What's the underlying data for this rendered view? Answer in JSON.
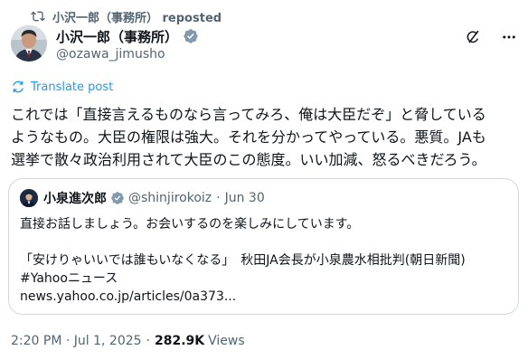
{
  "repost": {
    "text": "小沢一郎（事務所） reposted"
  },
  "post": {
    "author_name": "小沢一郎（事務所）",
    "handle": "@ozawa_jimusho",
    "translate_label": "Translate post",
    "body": "これでは「直接言えるものなら言ってみろ、俺は大臣だぞ」と脅している\nようなもの。大臣の権限は強大。それを分かってやっている。悪質。JAも\n選挙で散々政治利用されて大臣のこの態度。いい加減、怒るべきだろう。",
    "timestamp": "2:20 PM · Jul 1, 2025",
    "separator": "·",
    "views_count": "282.9K",
    "views_label": "Views"
  },
  "quote": {
    "author_name": "小泉進次郎",
    "handle": "@shinjirokoiz",
    "separator": "·",
    "date": "Jun 30",
    "body": "直接お話しましょう。お会いするのを楽しみにしています。\n\n「安けりゃいいでは誰もいなくなる」　秋田JA会長が小泉農水相批判(朝日新聞)\n#Yahooニュース\nnews.yahoo.co.jp/articles/0a373..."
  },
  "icons": {
    "repost": "repost-icon",
    "verified": "verified-badge-icon",
    "grok": "grok-icon",
    "more": "more-icon",
    "translate": "translate-icon"
  },
  "colors": {
    "accent": "#1d9bf0",
    "text_primary": "#0f1419",
    "text_secondary": "#536471",
    "border": "#cfd9de",
    "verified_badge": "#829aab"
  }
}
